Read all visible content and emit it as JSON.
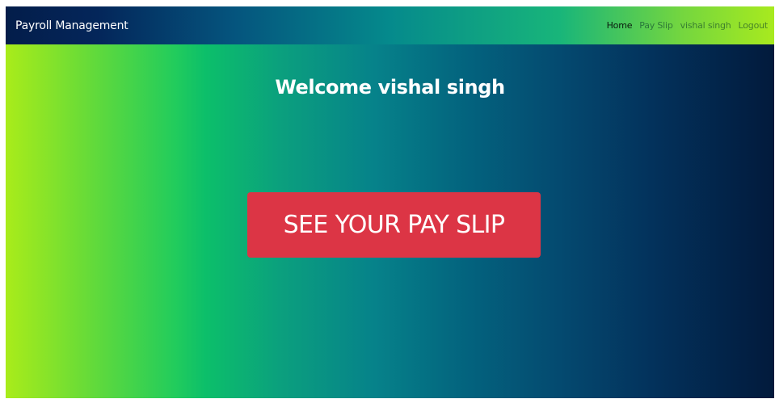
{
  "navbar": {
    "brand": "Payroll Management",
    "links": [
      {
        "label": "Home",
        "active": true
      },
      {
        "label": "Pay Slip",
        "active": false
      },
      {
        "label": "vishal singh",
        "active": false
      },
      {
        "label": "Logout",
        "active": false
      }
    ]
  },
  "main": {
    "welcome": "Welcome vishal singh",
    "cta_label": "SEE YOUR PAY SLIP"
  },
  "colors": {
    "cta": "#dc3545",
    "gradient_left": "#a9ec1a",
    "gradient_right": "#021a3c"
  }
}
